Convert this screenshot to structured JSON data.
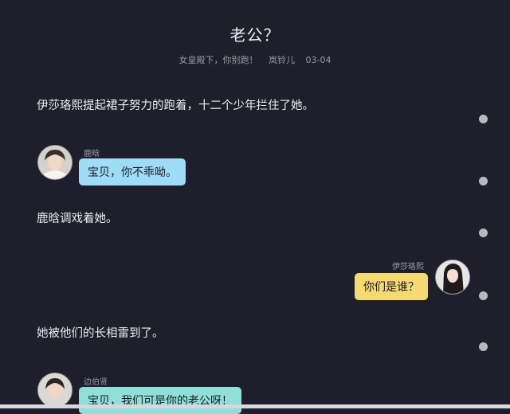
{
  "header": {
    "title": "老公？",
    "book": "女皇殿下，你别跑！",
    "author": "岚铃儿",
    "date": "03-04"
  },
  "messages": [
    {
      "type": "narration",
      "text": "伊莎珞熙提起裙子努力的跑着，十二个少年拦住了她。"
    },
    {
      "type": "chat",
      "side": "left",
      "speaker": "鹿晗",
      "text": "宝贝，你不乖呦。"
    },
    {
      "type": "narration",
      "text": "鹿晗调戏着她。"
    },
    {
      "type": "chat",
      "side": "right",
      "speaker": "伊莎珞熙",
      "text": "你们是谁？"
    },
    {
      "type": "narration",
      "text": "她被他们的长相雷到了。"
    },
    {
      "type": "chat",
      "side": "left",
      "speaker": "边伯贤",
      "text": "宝贝，我们可是你的老公呀！"
    }
  ],
  "colors": {
    "background": "#1f1f2b",
    "bubble_left": "#9fdcf7",
    "bubble_right": "#f5d973",
    "bubble_left_2": "#8fe0d8"
  },
  "icons": {
    "comment_dots": "comment-dot-icon"
  }
}
